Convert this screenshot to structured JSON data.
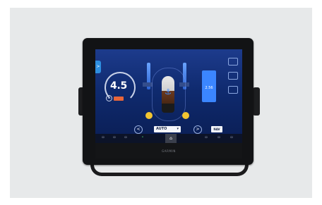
{
  "helm": {
    "speed": "4.5",
    "mode": "AUTO",
    "nav_button": "NAV",
    "depth_readout": "2.56",
    "tab_arrow": ">",
    "prev_arrow": "<",
    "next_arrow": ">",
    "minus": "−"
  },
  "device": {
    "brand": "GARMIN"
  },
  "colors": {
    "accent": "#3b86ff",
    "orange": "#e8663a",
    "propeller": "#f2c531",
    "screen": "#0f2a6e"
  },
  "icons": [
    "anchor-icon",
    "home-icon",
    "chevron-left-icon",
    "chevron-right-icon"
  ]
}
